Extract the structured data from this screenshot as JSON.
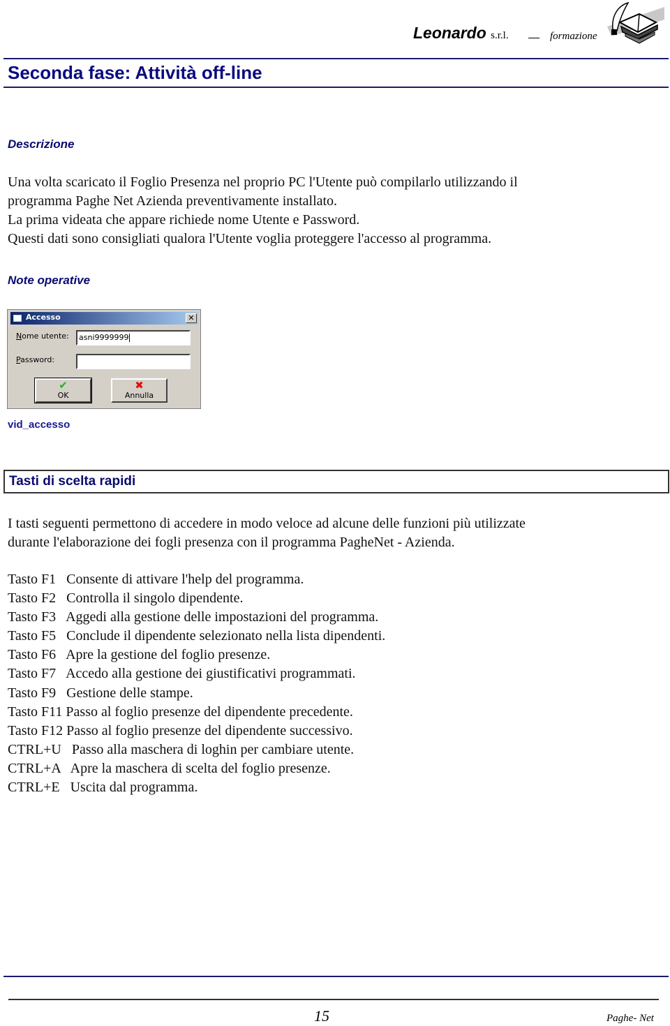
{
  "header": {
    "company": "Leonardo",
    "company_suffix": "s.r.l.",
    "division": "formazione",
    "logo": "book-quill-logo"
  },
  "page_title": "Seconda fase: Attività off-line",
  "description": {
    "heading": "Descrizione",
    "lines": [
      "Una volta scaricato il Foglio Presenza nel proprio PC l'Utente può compilarlo utilizzando il",
      "programma Paghe Net Azienda preventivamente installato.",
      "La prima videata che appare richiede nome Utente e Password.",
      "Questi dati sono consigliati qualora l'Utente voglia proteggere l'accesso al programma."
    ]
  },
  "notes": {
    "heading": "Note operative"
  },
  "dialog": {
    "title": "Accesso",
    "username_label": "Nome utente:",
    "username_mnemonic": "N",
    "username_label_rest": "ome utente:",
    "username_value": "asni9999999",
    "password_label": "Password:",
    "password_mnemonic": "P",
    "password_label_rest": "assword:",
    "password_value": "",
    "ok_label": "OK",
    "ok_icon": "✔",
    "ok_icon_color": "#22b022",
    "cancel_label": "Annulla",
    "cancel_icon": "✖",
    "cancel_icon_color": "#e01010",
    "close_glyph": "✕"
  },
  "figure_caption": "vid_accesso",
  "shortcuts": {
    "heading": "Tasti di scelta rapidi",
    "intro": [
      "I tasti seguenti permettono di accedere in modo veloce ad alcune delle funzioni più utilizzate",
      "durante l'elaborazione dei fogli presenza con il programma PagheNet - Azienda."
    ],
    "items": [
      {
        "key": "Tasto F1",
        "sep": "   ",
        "desc": "Consente di attivare l'help del programma."
      },
      {
        "key": "Tasto F2",
        "sep": "   ",
        "desc": "Controlla il singolo dipendente."
      },
      {
        "key": "Tasto F3",
        "sep": "   ",
        "desc": "Aggedi alla gestione delle impostazioni del programma."
      },
      {
        "key": "Tasto F5",
        "sep": "   ",
        "desc": "Conclude il dipendente selezionato nella lista dipendenti."
      },
      {
        "key": "Tasto F6",
        "sep": "   ",
        "desc": "Apre la gestione del foglio presenze."
      },
      {
        "key": "Tasto F7",
        "sep": "   ",
        "desc": "Accedo alla gestione dei giustificativi programmati."
      },
      {
        "key": "Tasto F9",
        "sep": "   ",
        "desc": "Gestione delle stampe."
      },
      {
        "key": "Tasto F11",
        "sep": " ",
        "desc": "Passo al foglio presenze del dipendente precedente."
      },
      {
        "key": "Tasto F12",
        "sep": " ",
        "desc": "Passo al foglio presenze del dipendente successivo."
      },
      {
        "key": "CTRL+U",
        "sep": "   ",
        "desc": "Passo alla maschera di loghin per cambiare utente."
      },
      {
        "key": "CTRL+A",
        "sep": "   ",
        "desc": "Apre la maschera di scelta del foglio presenze."
      },
      {
        "key": "CTRL+E",
        "sep": "   ",
        "desc": "Uscita dal programma."
      }
    ]
  },
  "footer": {
    "page_number": "15",
    "product": "Paghe- Net"
  },
  "colors": {
    "heading_blue": "#0a0a80",
    "rule_blue": "#1a1a6e"
  }
}
